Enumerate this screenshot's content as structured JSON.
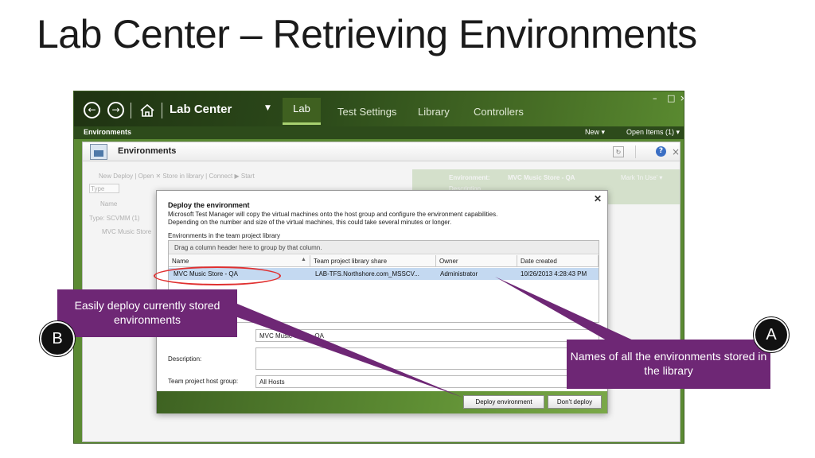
{
  "slide": {
    "title": "Lab Center – Retrieving Environments"
  },
  "app": {
    "title": "Lab Center",
    "tabs": [
      "Lab",
      "Test Settings",
      "Library",
      "Controllers"
    ],
    "active_tab": "Lab",
    "subbar_left": "Environments",
    "new_label": "New ▾",
    "open_items_label": "Open Items (1) ▾",
    "window_controls": [
      "–",
      "□",
      "×"
    ]
  },
  "panel": {
    "title": "Environments",
    "toolbar_dimmed": "New  Deploy  |  Open  ✕  Store in library  |  Connect  ▶ Start",
    "type_label": "Type",
    "name_header": "Name",
    "type_group": "Type: SCVMM (1)",
    "list_item": "MVC Music Store",
    "env_label": "Environment:",
    "env_value": "MVC Music Store - QA",
    "env_desc": "Description",
    "mark_in_use": "Mark 'In Use' ▾"
  },
  "dialog": {
    "title": "Deploy the environment",
    "line1": "Microsoft Test Manager will copy the virtual machines onto the host group and configure the environment capabilities.",
    "line2": "Depending on the number and size of the virtual machines, this could take several minutes or longer.",
    "section_label": "Environments in the team project library",
    "group_hint": "Drag a column header here to group by that column.",
    "columns": [
      "Name",
      "Team project library share",
      "Owner",
      "Date created"
    ],
    "row": {
      "name": "MVC Music Store - QA",
      "share": "LAB-TFS.Northshore.com_MSSCV...",
      "owner": "Administrator",
      "date": "10/26/2013 4:28:43 PM"
    },
    "name_value": "MVC Music Store - QA",
    "description_label": "Description:",
    "host_group_label": "Team project host group:",
    "host_group_value": "All Hosts",
    "deploy_button": "Deploy environment",
    "dont_deploy_button": "Don't deploy"
  },
  "callouts": {
    "b_text": "Easily deploy currently stored environments",
    "b_badge": "B",
    "a_text": "Names of all the environments stored in the library",
    "a_badge": "A",
    "color": "#6e2775"
  }
}
